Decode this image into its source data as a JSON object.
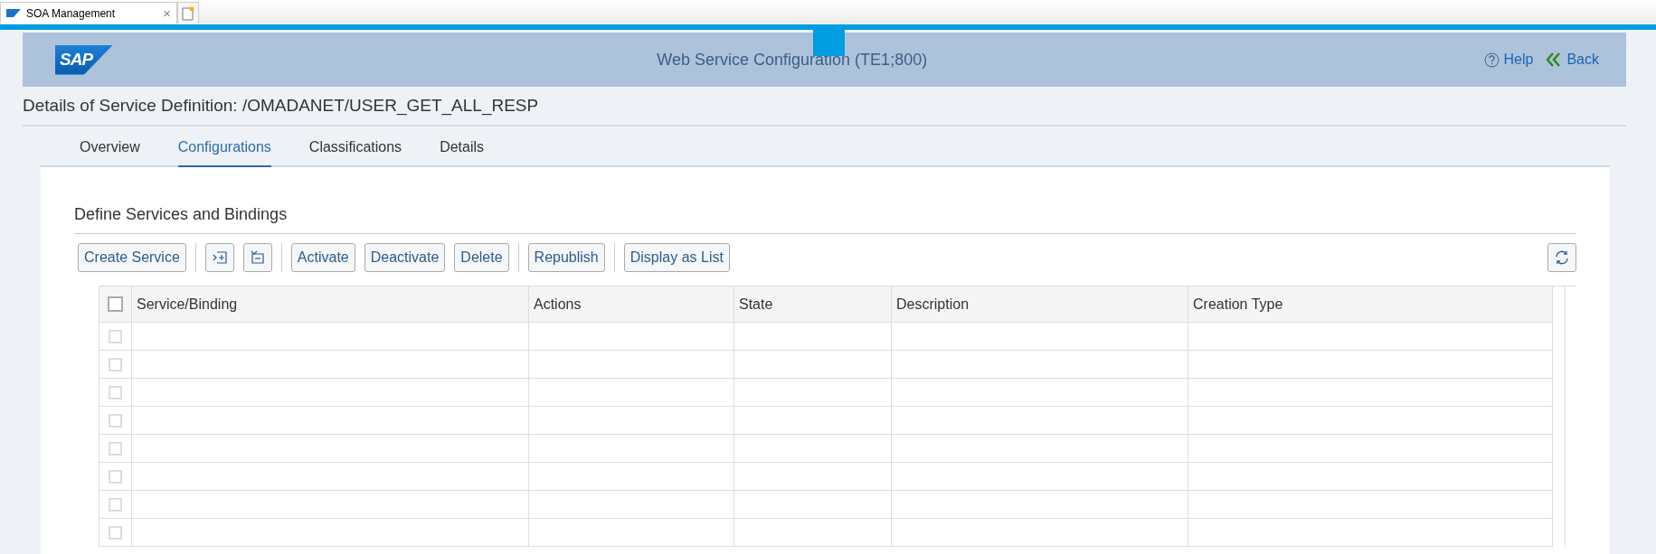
{
  "browser_tab": {
    "title": "SOA Management",
    "close": "×"
  },
  "header": {
    "logo": "SAP",
    "title": "Web Service Configuration (TE1;800)",
    "help": "Help",
    "back": "Back"
  },
  "page_title": "Details of Service Definition: /OMADANET/USER_GET_ALL_RESP",
  "tabs": [
    {
      "label": "Overview",
      "selected": false
    },
    {
      "label": "Configurations",
      "selected": true
    },
    {
      "label": "Classifications",
      "selected": false
    },
    {
      "label": "Details",
      "selected": false
    }
  ],
  "section_title": "Define Services and Bindings",
  "toolbar": [
    {
      "buttons": [
        {
          "kind": "text",
          "label": "Create Service"
        }
      ]
    },
    {
      "buttons": [
        {
          "kind": "icon"
        },
        {
          "kind": "icon"
        }
      ]
    },
    {
      "buttons": [
        {
          "kind": "text",
          "label": "Activate"
        },
        {
          "kind": "text",
          "label": "Deactivate"
        },
        {
          "kind": "text",
          "label": "Delete"
        }
      ]
    },
    {
      "buttons": [
        {
          "kind": "text",
          "label": "Republish"
        }
      ]
    },
    {
      "buttons": [
        {
          "kind": "text",
          "label": "Display as List"
        }
      ]
    }
  ],
  "table": {
    "select_all": {
      "checked": false
    },
    "columns": [
      "Service/Binding",
      "Actions",
      "State",
      "Description",
      "Creation Type"
    ],
    "rows": [
      {
        "checked": false
      },
      {
        "checked": false
      },
      {
        "checked": false
      },
      {
        "checked": false
      },
      {
        "checked": false
      },
      {
        "checked": false
      },
      {
        "checked": false
      },
      {
        "checked": false
      }
    ]
  }
}
